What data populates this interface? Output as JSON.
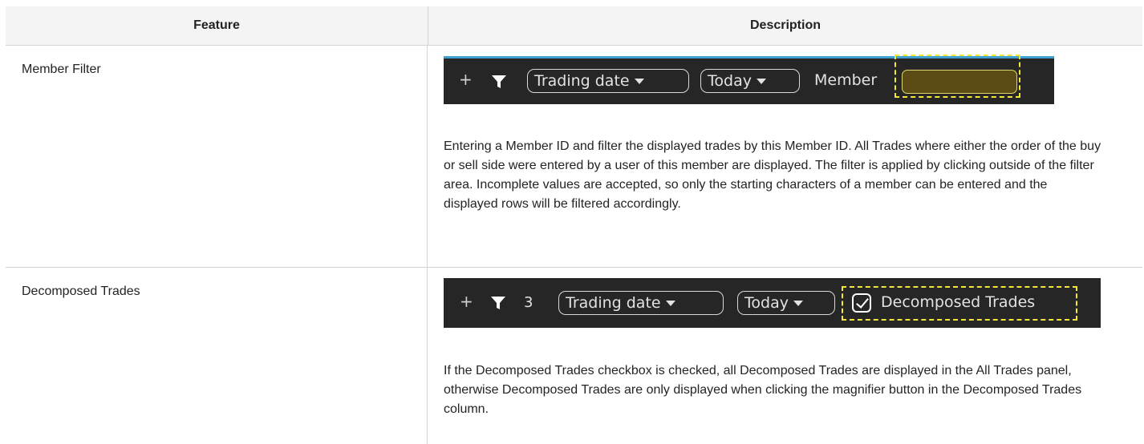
{
  "table": {
    "header": {
      "feature": "Feature",
      "description": "Description"
    },
    "rows": [
      {
        "feature": "Member Filter",
        "toolbar": {
          "plus": "+",
          "trading_date": "Trading date",
          "today": "Today",
          "member_label": "Member",
          "member_value": ""
        },
        "description": "Entering a Member ID and filter the displayed trades by this Member ID. All Trades where either the order of the buy or sell side were entered by a user of this member are displayed. The filter is applied by clicking outside of the filter area. Incomplete values are accepted, so only the starting characters of a member can be entered and the displayed rows will be filtered accordingly."
      },
      {
        "feature": "Decomposed Trades",
        "toolbar": {
          "plus": "+",
          "filter_count": "3",
          "trading_date": "Trading date",
          "today": "Today",
          "checkbox_label": "Decomposed Trades",
          "checked": true
        },
        "description": "If the Decomposed Trades checkbox is checked, all Decomposed Trades are displayed in the All Trades panel, otherwise Decomposed Trades are only displayed when clicking the magnifier button in the Decomposed Trades column."
      }
    ]
  },
  "colors": {
    "header_bg": "#f4f4f4",
    "border": "#d4d4d4",
    "toolbar_bg": "#262626",
    "accent_top": "#3e9fd1",
    "highlight": "#f2e63a"
  }
}
